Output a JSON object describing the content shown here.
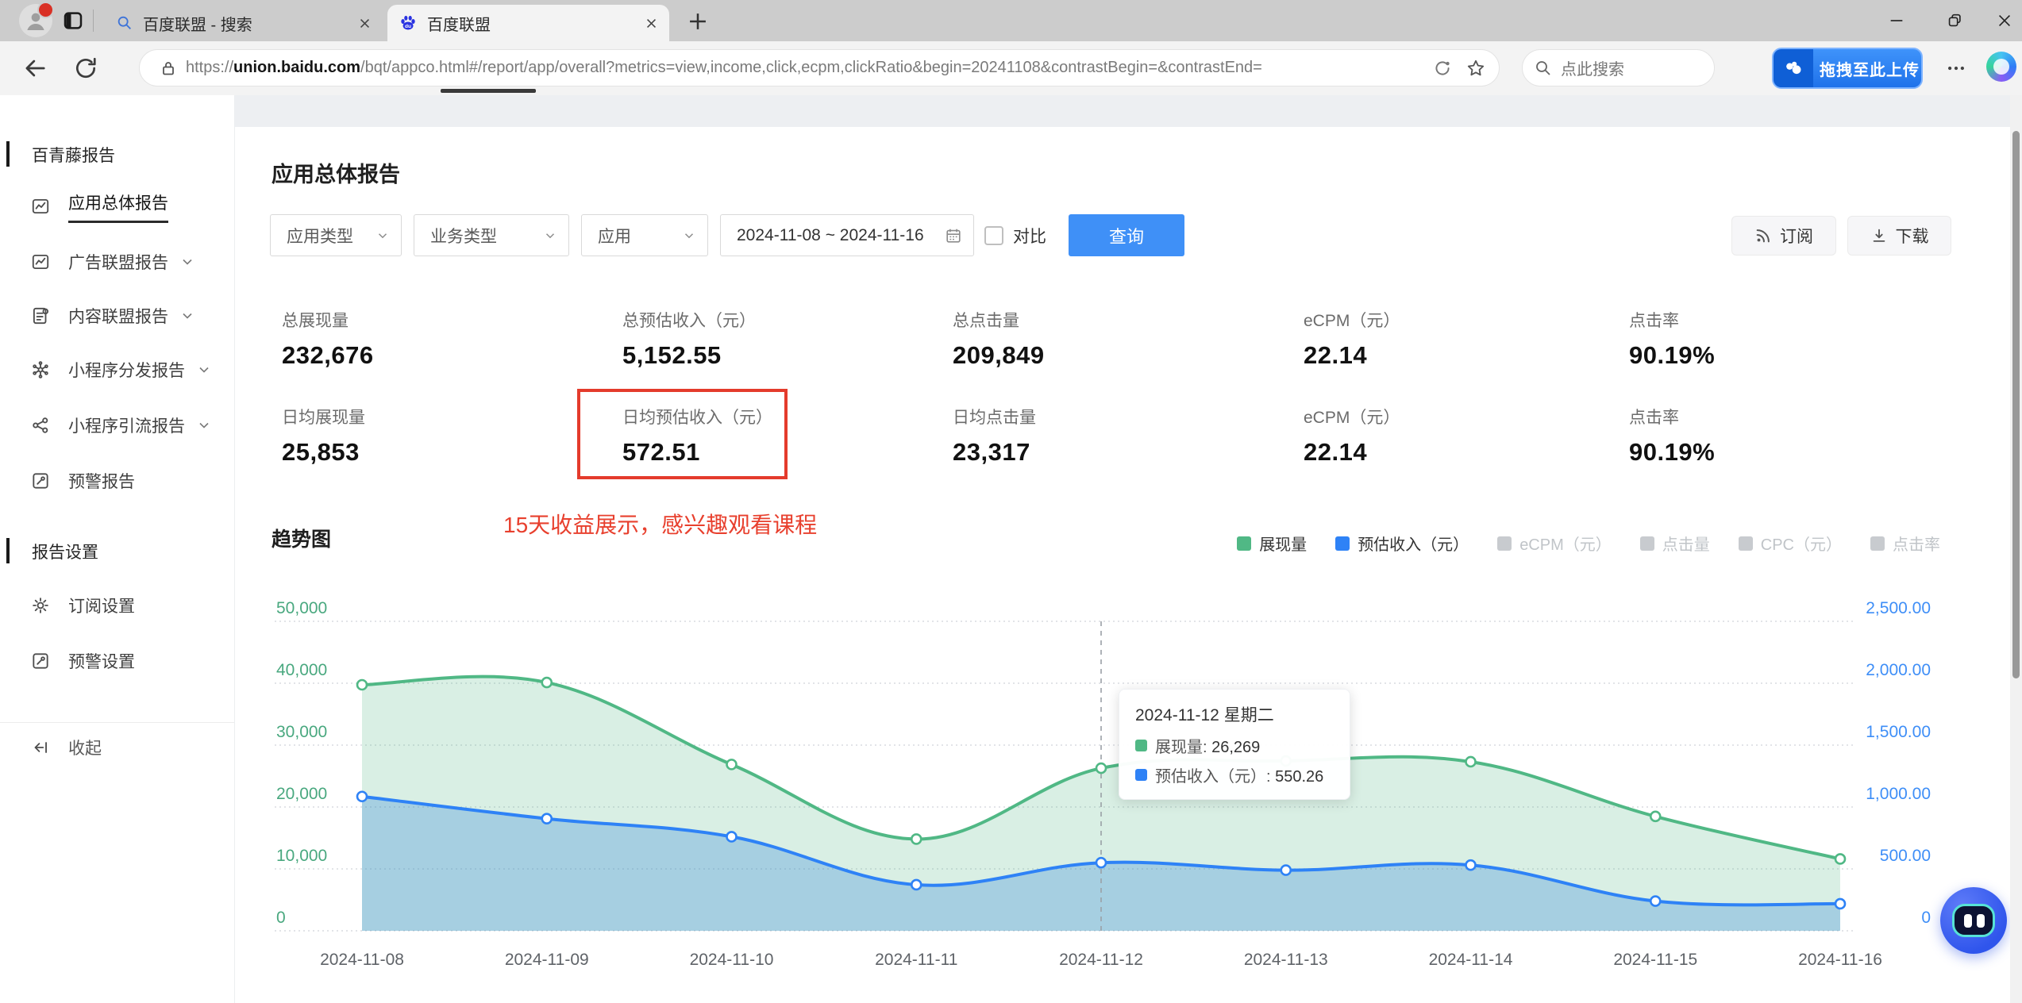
{
  "browser": {
    "tabs": [
      {
        "title": "百度联盟 - 搜索",
        "icon": "search-icon"
      },
      {
        "title": "百度联盟",
        "icon": "baidu-paw-icon"
      }
    ],
    "new_tab": "+",
    "url_scheme": "https://",
    "url_domain": "union.baidu.com",
    "url_path": "/bqt/appco.html#/report/app/overall?metrics=view,income,click,ecpm,clickRatio&begin=20241108&contrastBegin=&contrastEnd=",
    "search_placeholder": "点此搜索",
    "upload_badge": "拖拽至此上传"
  },
  "sidebar": {
    "section1": "百青藤报告",
    "items": [
      {
        "label": "应用总体报告",
        "icon": "report",
        "active": true,
        "chevron": false
      },
      {
        "label": "广告联盟报告",
        "icon": "report",
        "active": false,
        "chevron": true
      },
      {
        "label": "内容联盟报告",
        "icon": "doc",
        "active": false,
        "chevron": true
      },
      {
        "label": "小程序分发报告",
        "icon": "hub",
        "active": false,
        "chevron": true
      },
      {
        "label": "小程序引流报告",
        "icon": "share",
        "active": false,
        "chevron": true
      },
      {
        "label": "预警报告",
        "icon": "flag",
        "active": false,
        "chevron": false
      }
    ],
    "section2": "报告设置",
    "settings": [
      {
        "label": "订阅设置",
        "icon": "gear"
      },
      {
        "label": "预警设置",
        "icon": "flag"
      }
    ],
    "collapse": "收起"
  },
  "page": {
    "title": "应用总体报告",
    "filters": {
      "app_type": "应用类型",
      "biz_type": "业务类型",
      "app": "应用",
      "date_range": "2024-11-08 ~ 2024-11-16",
      "compare": "对比",
      "query": "查询",
      "subscribe": "订阅",
      "download": "下载"
    },
    "stats_rows": [
      [
        {
          "label": "总展现量",
          "value": "232,676"
        },
        {
          "label": "总预估收入（元）",
          "value": "5,152.55"
        },
        {
          "label": "总点击量",
          "value": "209,849"
        },
        {
          "label": "eCPM（元）",
          "value": "22.14"
        },
        {
          "label": "点击率",
          "value": "90.19%"
        }
      ],
      [
        {
          "label": "日均展现量",
          "value": "25,853"
        },
        {
          "label": "日均预估收入（元）",
          "value": "572.51"
        },
        {
          "label": "日均点击量",
          "value": "23,317"
        },
        {
          "label": "eCPM（元）",
          "value": "22.14"
        },
        {
          "label": "点击率",
          "value": "90.19%"
        }
      ]
    ],
    "annotation": "15天收益展示，感兴趣观看课程",
    "chart_title": "趋势图"
  },
  "legend": [
    {
      "label": "展现量",
      "color": "#50b885",
      "active": true
    },
    {
      "label": "预估收入（元）",
      "color": "#2e82f6",
      "active": true
    },
    {
      "label": "eCPM（元）",
      "color": "#c8cbcf",
      "active": false
    },
    {
      "label": "点击量",
      "color": "#c8cbcf",
      "active": false
    },
    {
      "label": "CPC（元）",
      "color": "#c8cbcf",
      "active": false
    },
    {
      "label": "点击率",
      "color": "#c8cbcf",
      "active": false
    }
  ],
  "chart_data": {
    "type": "area",
    "x": [
      "2024-11-08",
      "2024-11-09",
      "2024-11-10",
      "2024-11-11",
      "2024-11-12",
      "2024-11-13",
      "2024-11-14",
      "2024-11-15",
      "2024-11-16"
    ],
    "series": [
      {
        "name": "展现量",
        "axis": "left",
        "color": "#50b885",
        "fill": "rgba(80,184,133,0.22)",
        "values": [
          39743,
          40120,
          26875,
          14820,
          26269,
          27450,
          27310,
          18480,
          11609
        ]
      },
      {
        "name": "预估收入（元）",
        "axis": "right",
        "color": "#2e82f6",
        "fill": "rgba(58,141,222,0.32)",
        "values": [
          1085,
          906,
          760,
          372,
          550.26,
          490,
          531,
          240,
          218.29
        ]
      }
    ],
    "left_axis": {
      "color": "#49a87f",
      "max": 50000,
      "ticks": [
        "0",
        "10,000",
        "20,000",
        "30,000",
        "40,000",
        "50,000"
      ]
    },
    "right_axis": {
      "color": "#3e8ef7",
      "max": 2500,
      "ticks": [
        "0",
        "500.00",
        "1,000.00",
        "1,500.00",
        "2,000.00",
        "2,500.00"
      ]
    },
    "grid": true,
    "highlight_index": 4,
    "legend_position": "top-right"
  },
  "tooltip": {
    "title": "2024-11-12 星期二",
    "rows": [
      {
        "label": "展现量",
        "value": "26,269",
        "color": "#50b885"
      },
      {
        "label": "预估收入（元）",
        "value": "550.26",
        "color": "#2e82f6"
      }
    ]
  }
}
